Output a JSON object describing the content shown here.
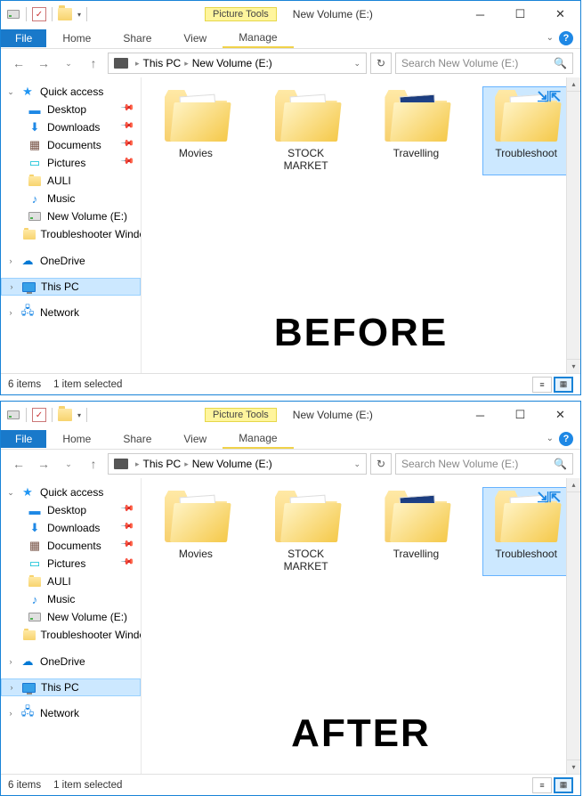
{
  "window": {
    "title": "New Volume (E:)",
    "picture_tools_label": "Picture Tools"
  },
  "ribbon": {
    "file": "File",
    "home": "Home",
    "share": "Share",
    "view": "View",
    "manage": "Manage"
  },
  "nav": {
    "breadcrumb": {
      "root": "This PC",
      "current": "New Volume (E:)"
    },
    "search_placeholder": "Search New Volume (E:)"
  },
  "sidebar": {
    "quick_access": "Quick access",
    "items": [
      {
        "label": "Desktop",
        "pinned": true
      },
      {
        "label": "Downloads",
        "pinned": true
      },
      {
        "label": "Documents",
        "pinned": true
      },
      {
        "label": "Pictures",
        "pinned": true
      },
      {
        "label": "AULI",
        "pinned": false
      },
      {
        "label": "Music",
        "pinned": false
      },
      {
        "label": "New Volume (E:)",
        "pinned": false
      },
      {
        "label": "Troubleshooter Windows",
        "pinned": false
      }
    ],
    "onedrive": "OneDrive",
    "this_pc": "This PC",
    "network": "Network"
  },
  "folders": [
    {
      "label": "Movies",
      "selected": false
    },
    {
      "label": "STOCK MARKET",
      "selected": false
    },
    {
      "label": "Travelling",
      "selected": false
    },
    {
      "label": "Troubleshoot",
      "selected": true
    }
  ],
  "status": {
    "count": "6 items",
    "selected": "1 item selected"
  },
  "comparison": {
    "before": "BEFORE",
    "after": "AFTER"
  }
}
